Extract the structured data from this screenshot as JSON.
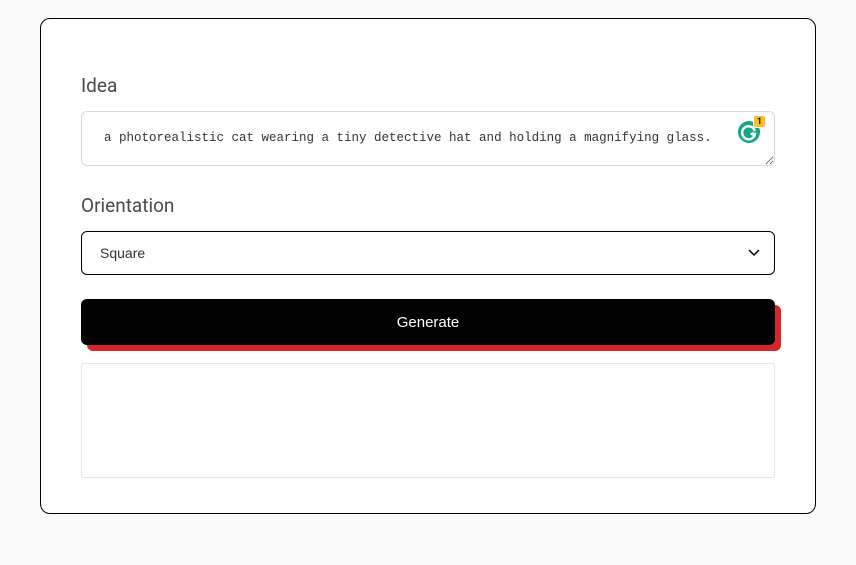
{
  "form": {
    "idea": {
      "label": "Idea",
      "value": "a photorealistic cat wearing a tiny detective hat and holding a magnifying glass."
    },
    "orientation": {
      "label": "Orientation",
      "selected": "Square"
    },
    "generate_label": "Generate"
  },
  "grammarly": {
    "count": "1"
  }
}
